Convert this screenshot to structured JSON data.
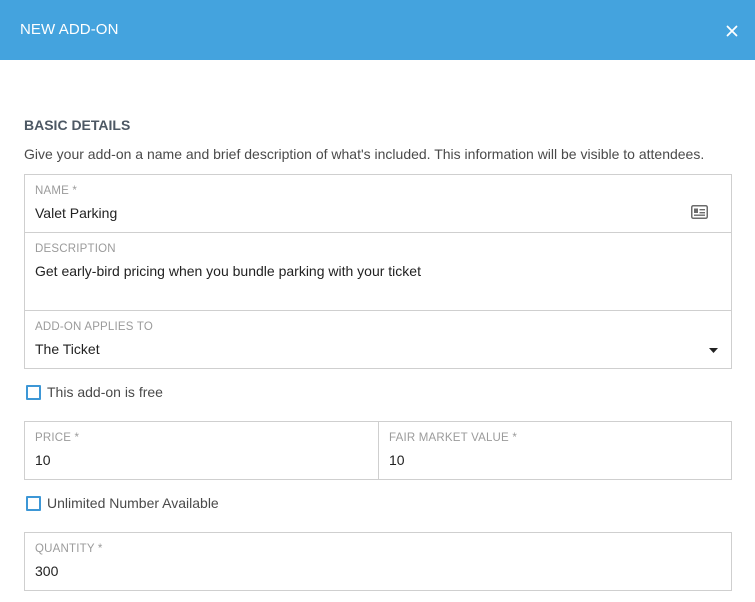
{
  "dialog": {
    "title": "NEW ADD-ON",
    "close_icon": "close-icon",
    "header_color": "#44a3de"
  },
  "basic_details": {
    "title": "BASIC DETAILS",
    "description": "Give your add-on a name and brief description of what's included. This information will be visible to attendees."
  },
  "name_field": {
    "label": "NAME *",
    "value": "Valet Parking",
    "icon": "contact-card-icon"
  },
  "description_field": {
    "label": "DESCRIPTION",
    "value": "Get early-bird pricing when you bundle parking with your ticket"
  },
  "applies_to_field": {
    "label": "ADD-ON APPLIES TO",
    "value": "The Ticket",
    "icon": "caret-down-icon"
  },
  "free_checkbox": {
    "label": "This add-on is free",
    "checked": false
  },
  "price_field": {
    "label": "PRICE *",
    "value": "10"
  },
  "fair_market_field": {
    "label": "FAIR MARKET VALUE *",
    "value": "10"
  },
  "unlimited_checkbox": {
    "label": "Unlimited Number Available",
    "checked": false
  },
  "quantity_field": {
    "label": "QUANTITY *",
    "value": "300"
  },
  "accent_color": "#3d97d6"
}
